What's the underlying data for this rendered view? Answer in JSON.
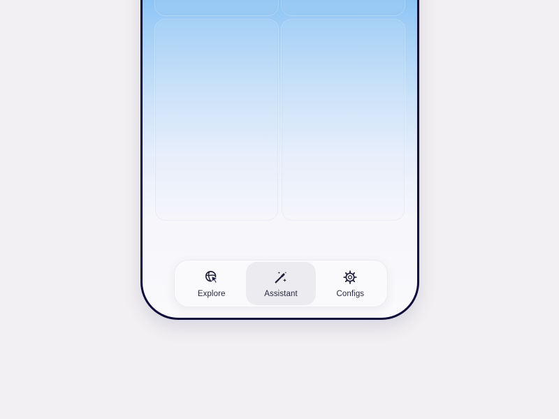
{
  "tabbar": {
    "active_tab": "assistant",
    "tabs": [
      {
        "id": "explore",
        "label": "Explore",
        "icon": "globe-cursor-icon"
      },
      {
        "id": "assistant",
        "label": "Assistant",
        "icon": "magic-wand-icon"
      },
      {
        "id": "configs",
        "label": "Configs",
        "icon": "gear-icon"
      }
    ]
  },
  "colors": {
    "page_background": "#f2f0f2",
    "phone_frame": "#0d0b3a",
    "gradient_top": "#6fb6f2",
    "gradient_bottom": "#fafafc",
    "active_tab_background": "#ececf0",
    "icon_color": "#1d1f3a"
  }
}
